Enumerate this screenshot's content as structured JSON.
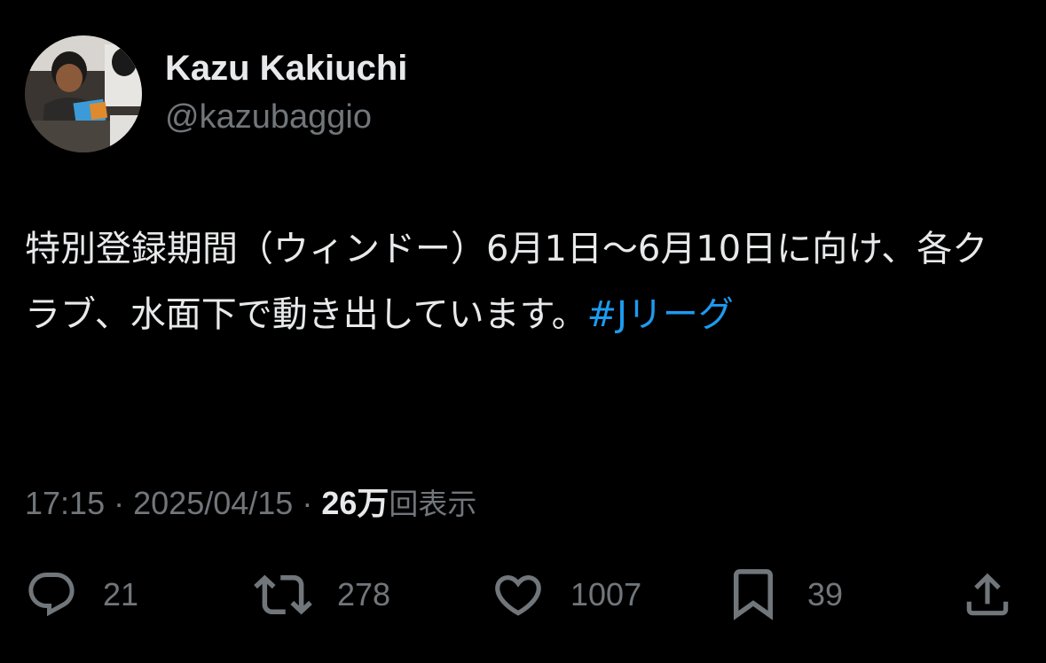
{
  "author": {
    "display_name": "Kazu Kakiuchi",
    "handle": "@kazubaggio"
  },
  "tweet": {
    "text": "特別登録期間（ウィンドー）6月1日〜6月10日に向け、各クラブ、水面下で動き出しています。",
    "hashtag": "#Jリーグ"
  },
  "meta": {
    "time": "17:15",
    "separator": "·",
    "date": "2025/04/15",
    "views_count": "26万",
    "views_label": "回表示"
  },
  "actions": {
    "replies": "21",
    "retweets": "278",
    "likes": "1007",
    "bookmarks": "39"
  },
  "icons": {
    "reply": "reply-icon",
    "retweet": "retweet-icon",
    "like": "heart-icon",
    "bookmark": "bookmark-icon",
    "share": "share-icon"
  },
  "colors": {
    "background": "#000000",
    "text_primary": "#e7e9ea",
    "text_secondary": "#71767b",
    "link": "#1d9bf0"
  }
}
